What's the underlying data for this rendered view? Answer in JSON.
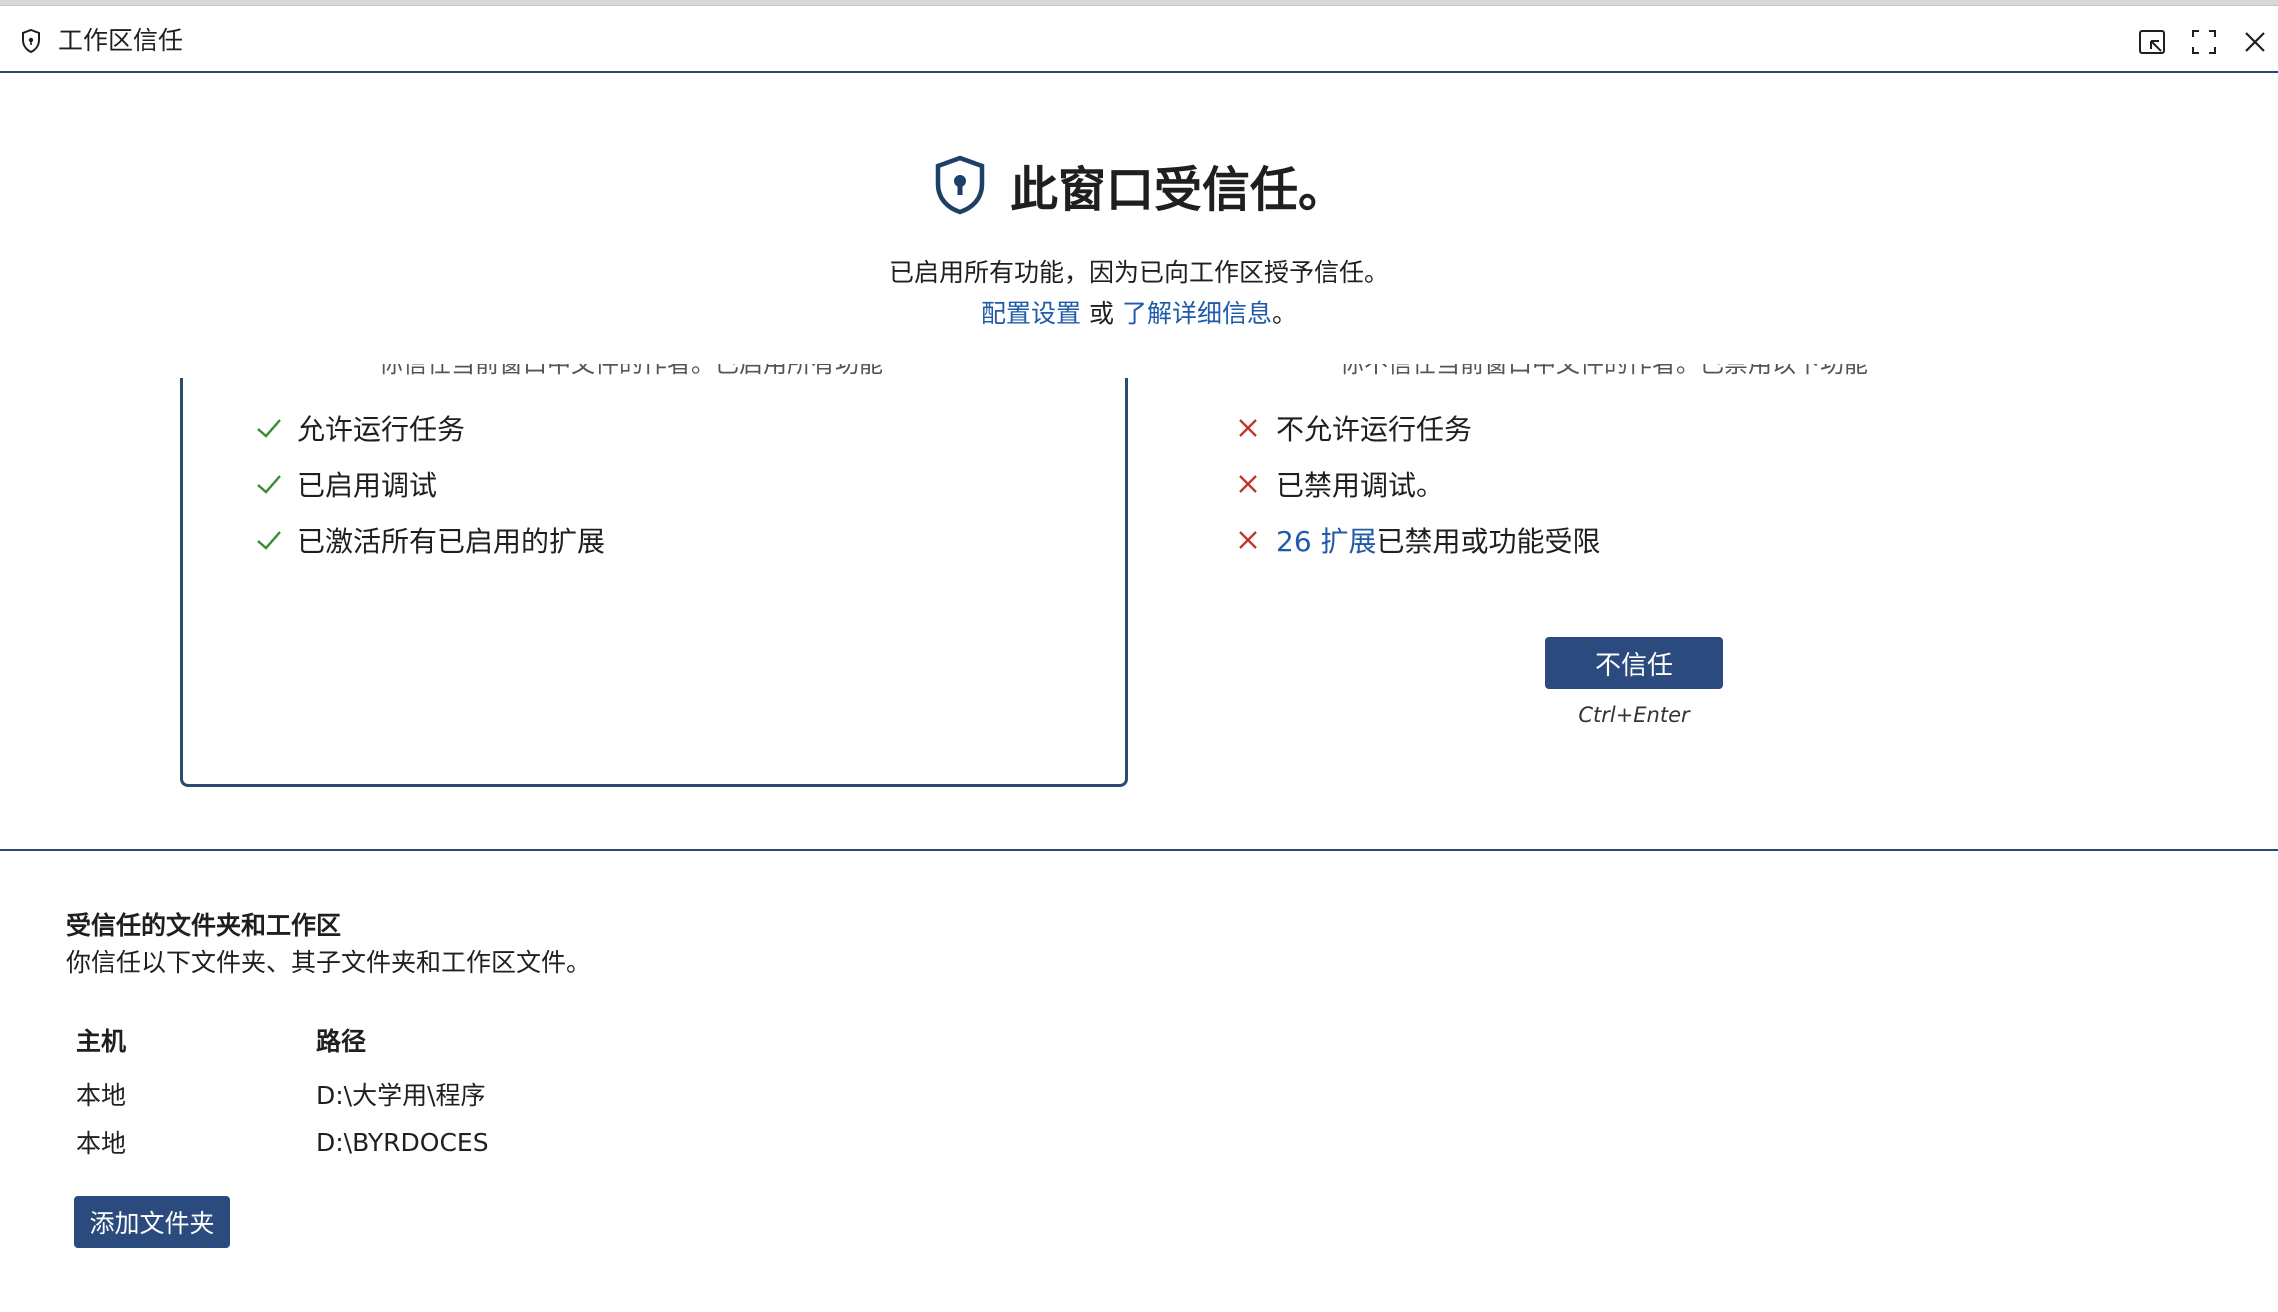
{
  "titlebar": {
    "title": "工作区信任",
    "icons": [
      "shield-icon",
      "open-editor-icon",
      "fullscreen-icon",
      "close-icon"
    ]
  },
  "header": {
    "heading": "此窗口受信任。",
    "subtitle": "已启用所有功能，因为已向工作区授予信任。",
    "configure_link": "配置设置",
    "or_text": "或",
    "learn_link": "了解详细信息",
    "period": "。"
  },
  "trusted_card": {
    "cut_heading": "你信任当前窗口中文件的作者。已启用所有功能",
    "items": [
      "允许运行任务",
      "已启用调试",
      "已激活所有已启用的扩展"
    ]
  },
  "restricted_card": {
    "cut_heading": "你不信任当前窗口中文件的作者。已禁用以下功能",
    "items": [
      "不允许运行任务",
      "已禁用调试。"
    ],
    "extensions_link": "26 扩展",
    "extensions_suffix": "已禁用或功能受限",
    "dont_trust_button": "不信任",
    "shortcut": "Ctrl+Enter"
  },
  "trusted_folders": {
    "title": "受信任的文件夹和工作区",
    "description": "你信任以下文件夹、其子文件夹和工作区文件。",
    "columns": {
      "host": "主机",
      "path": "路径"
    },
    "rows": [
      {
        "host": "本地",
        "path": "D:\\大学用\\程序"
      },
      {
        "host": "本地",
        "path": "D:\\BYRDOCES"
      }
    ],
    "add_button": "添加文件夹"
  },
  "colors": {
    "accent": "#2b4a7e",
    "link": "#1f5ba8",
    "check": "#388a34",
    "cross": "#c0392b"
  }
}
